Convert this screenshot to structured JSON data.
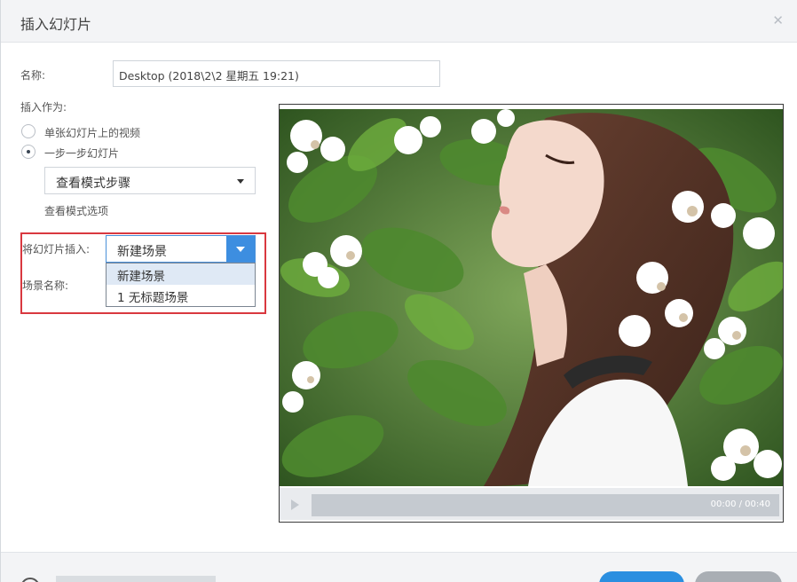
{
  "dialog": {
    "title": "插入幻灯片",
    "close_icon": "close-icon"
  },
  "form": {
    "name_label": "名称:",
    "name_value": "Desktop (2018\\2\\2 星期五 19:21)",
    "insert_as_label": "插入作为:",
    "option_single": "单张幻灯片上的视频",
    "option_step": "一步一步幻灯片",
    "view_mode_select": "查看模式步骤",
    "view_mode_options_label": "查看模式选项",
    "insert_slide_label": "将幻灯片插入:",
    "scene_select_value": "新建场景",
    "scene_name_label": "场景名称:",
    "scene_options": [
      "新建场景",
      "1 无标题场景"
    ]
  },
  "preview": {
    "time": "00:00 / 00:40"
  },
  "colors": {
    "accent": "#3d8ee0",
    "highlight_border": "#d9383f"
  }
}
